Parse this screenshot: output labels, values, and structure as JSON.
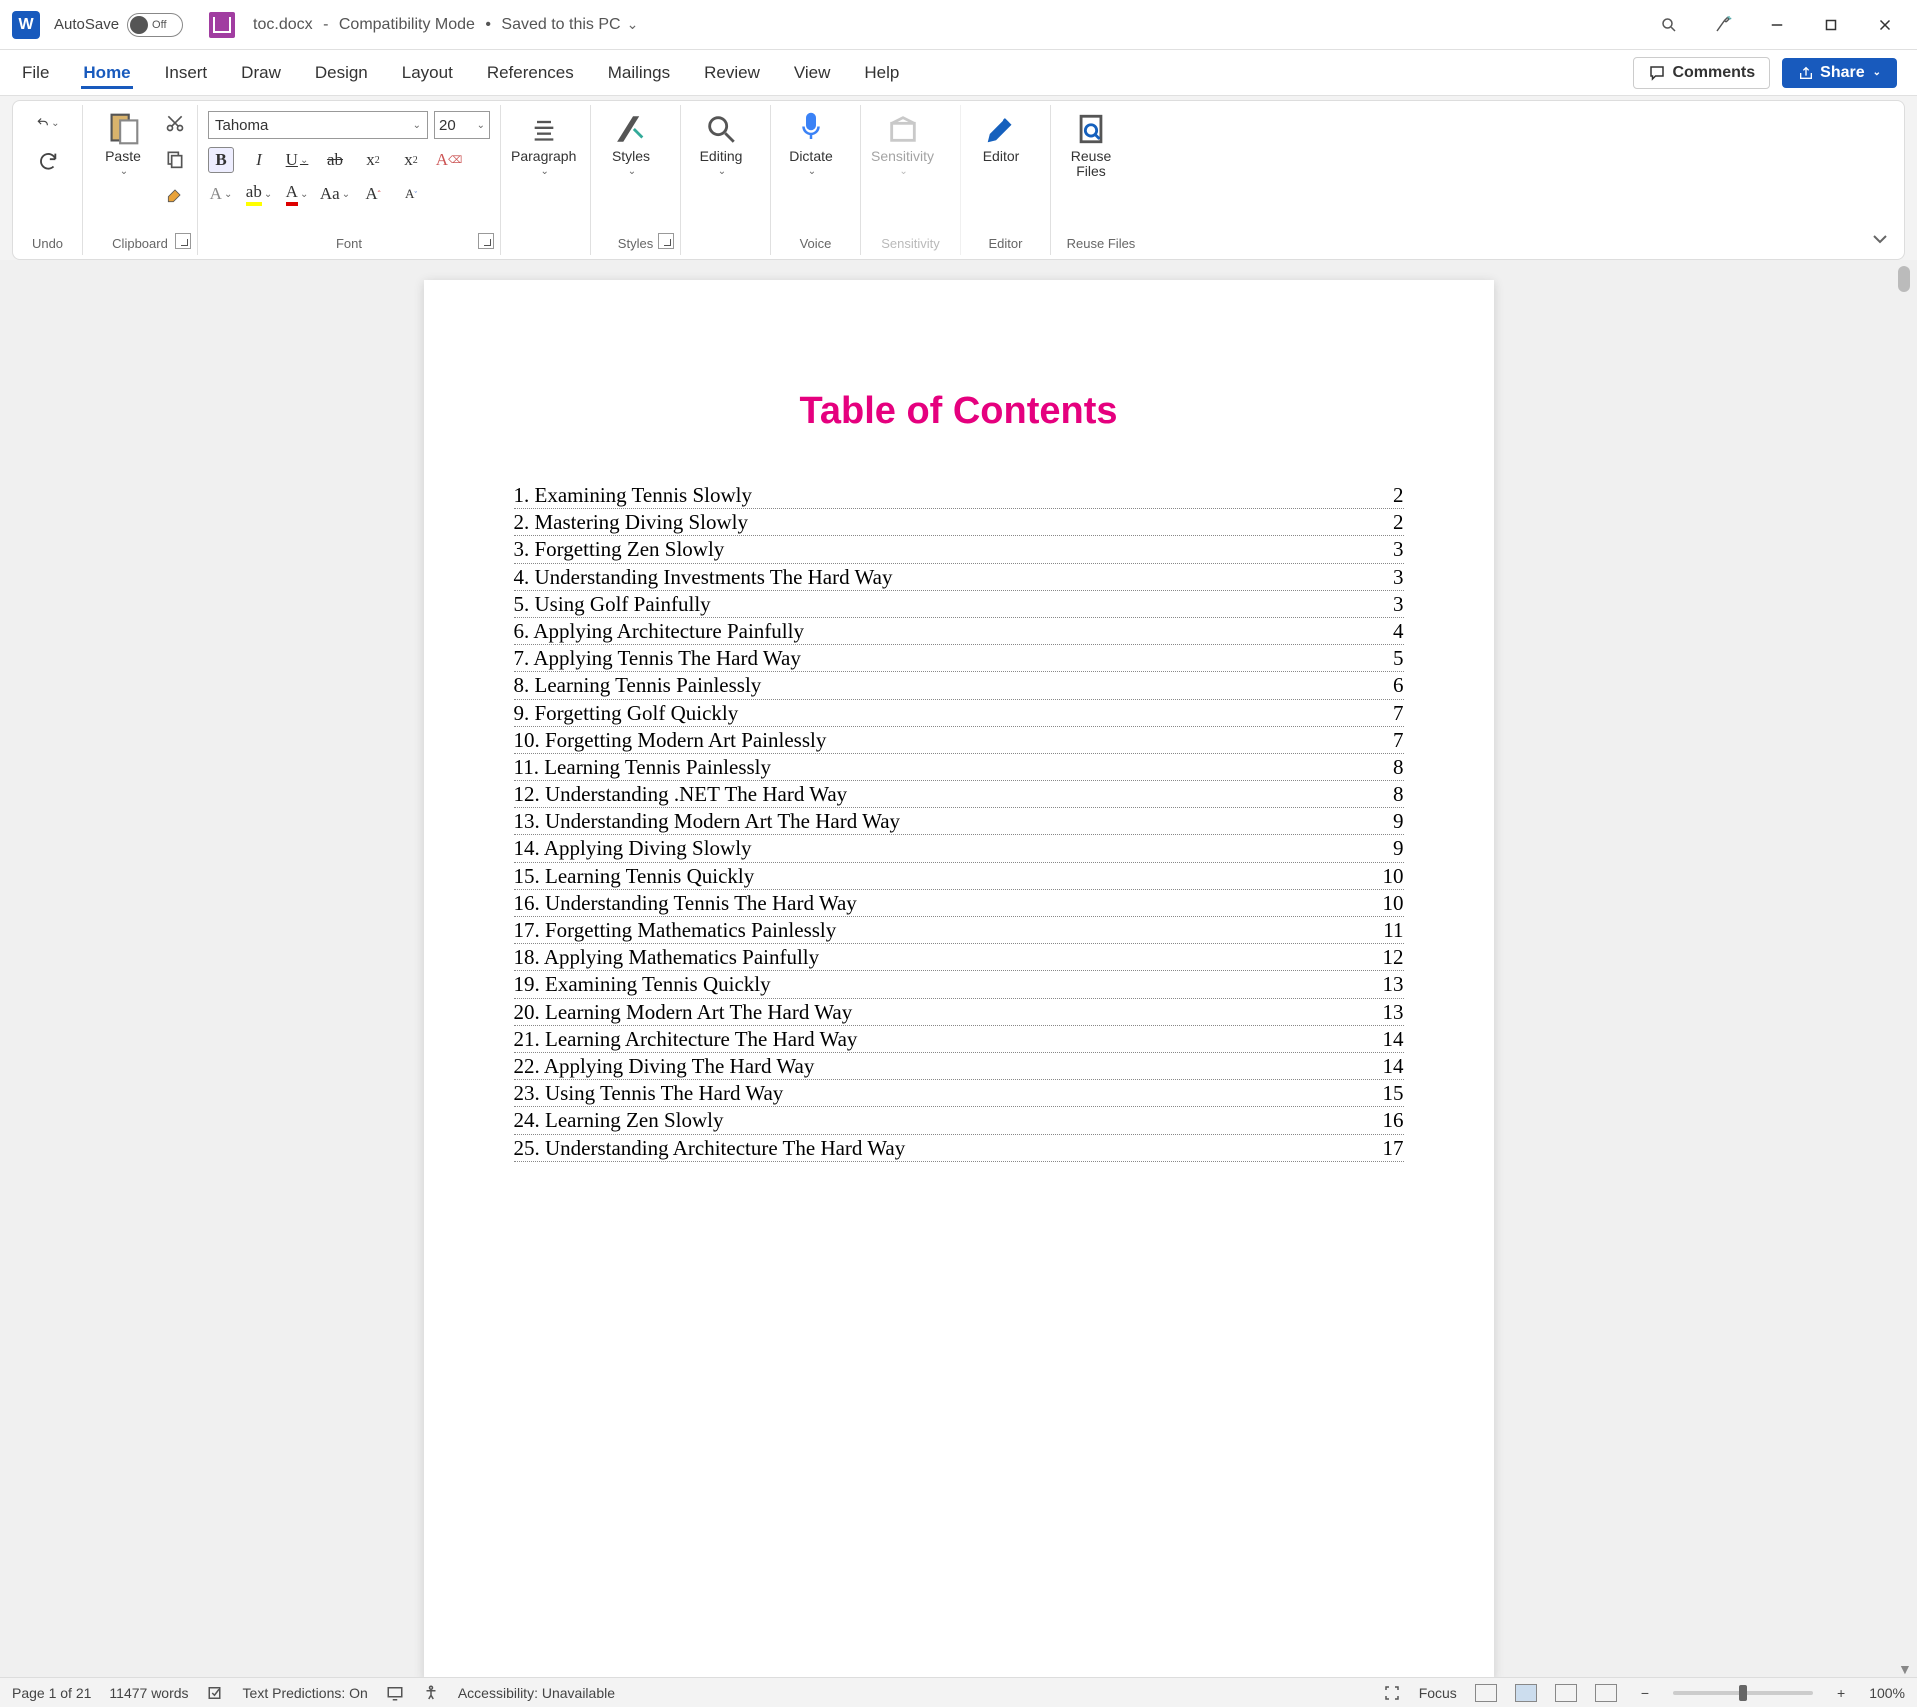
{
  "titlebar": {
    "autosave_label": "AutoSave",
    "autosave_state": "Off",
    "filename": "toc.docx",
    "mode": "Compatibility Mode",
    "saved_status": "Saved to this PC"
  },
  "tabs": {
    "items": [
      "File",
      "Home",
      "Insert",
      "Draw",
      "Design",
      "Layout",
      "References",
      "Mailings",
      "Review",
      "View",
      "Help"
    ],
    "active": "Home",
    "comments_label": "Comments",
    "share_label": "Share"
  },
  "ribbon": {
    "undo": {
      "label": "Undo"
    },
    "clipboard": {
      "label": "Clipboard",
      "paste": "Paste"
    },
    "font": {
      "label": "Font",
      "family": "Tahoma",
      "size": "20"
    },
    "paragraph": {
      "label": "Paragraph"
    },
    "styles": {
      "label": "Styles",
      "btn": "Styles"
    },
    "editing": {
      "label": "Editing"
    },
    "voice": {
      "label": "Voice",
      "dictate": "Dictate"
    },
    "sensitivity": {
      "label": "Sensitivity",
      "btn": "Sensitivity"
    },
    "editor": {
      "label": "Editor",
      "btn": "Editor"
    },
    "reuse": {
      "label": "Reuse Files",
      "btn": "Reuse\nFiles"
    }
  },
  "document": {
    "title": "Table of Contents",
    "toc": [
      {
        "n": "1",
        "t": "Examining Tennis Slowly",
        "p": "2"
      },
      {
        "n": "2",
        "t": "Mastering Diving Slowly",
        "p": "2"
      },
      {
        "n": "3",
        "t": "Forgetting Zen Slowly",
        "p": "3"
      },
      {
        "n": "4",
        "t": "Understanding Investments The Hard Way",
        "p": "3"
      },
      {
        "n": "5",
        "t": "Using Golf Painfully",
        "p": "3"
      },
      {
        "n": "6",
        "t": "Applying Architecture Painfully",
        "p": "4"
      },
      {
        "n": "7",
        "t": "Applying Tennis The Hard Way",
        "p": "5"
      },
      {
        "n": "8",
        "t": "Learning Tennis Painlessly",
        "p": "6"
      },
      {
        "n": "9",
        "t": "Forgetting Golf Quickly",
        "p": "7"
      },
      {
        "n": "10",
        "t": "Forgetting Modern Art Painlessly",
        "p": "7"
      },
      {
        "n": "11",
        "t": "Learning Tennis Painlessly",
        "p": "8"
      },
      {
        "n": "12",
        "t": "Understanding .NET The Hard Way",
        "p": "8"
      },
      {
        "n": "13",
        "t": "Understanding Modern Art The Hard Way",
        "p": "9"
      },
      {
        "n": "14",
        "t": "Applying Diving Slowly",
        "p": "9"
      },
      {
        "n": "15",
        "t": "Learning Tennis Quickly",
        "p": "10"
      },
      {
        "n": "16",
        "t": "Understanding Tennis The Hard Way",
        "p": "10"
      },
      {
        "n": "17",
        "t": "Forgetting Mathematics Painlessly",
        "p": "11"
      },
      {
        "n": "18",
        "t": "Applying Mathematics Painfully",
        "p": "12"
      },
      {
        "n": "19",
        "t": "Examining Tennis Quickly",
        "p": "13"
      },
      {
        "n": "20",
        "t": "Learning Modern Art The Hard Way",
        "p": "13"
      },
      {
        "n": "21",
        "t": "Learning Architecture The Hard Way",
        "p": "14"
      },
      {
        "n": "22",
        "t": "Applying Diving The Hard Way",
        "p": "14"
      },
      {
        "n": "23",
        "t": "Using Tennis The Hard Way",
        "p": "15"
      },
      {
        "n": "24",
        "t": "Learning Zen Slowly",
        "p": "16"
      },
      {
        "n": "25",
        "t": "Understanding Architecture The Hard Way",
        "p": "17"
      }
    ]
  },
  "statusbar": {
    "page": "Page 1 of 21",
    "words": "11477 words",
    "predictions": "Text Predictions: On",
    "accessibility": "Accessibility: Unavailable",
    "focus": "Focus",
    "zoom": "100%"
  }
}
